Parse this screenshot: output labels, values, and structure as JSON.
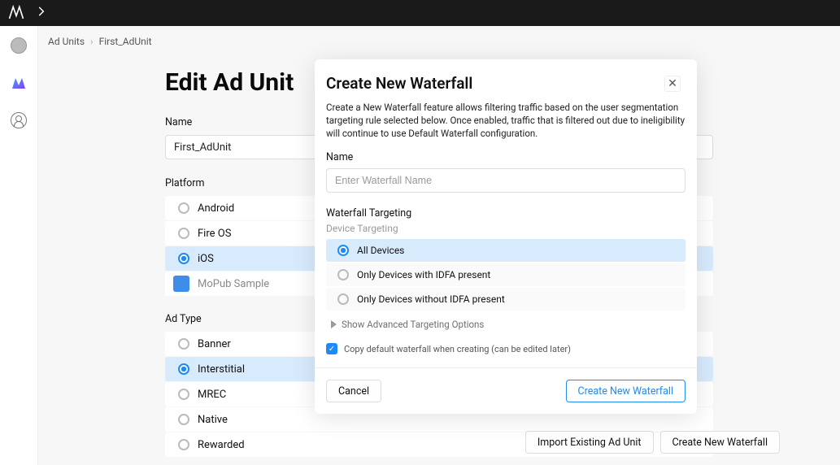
{
  "breadcrumb": {
    "root": "Ad Units",
    "current": "First_AdUnit"
  },
  "page_title": "Edit Ad Unit",
  "name_label": "Name",
  "name_value": "First_AdUnit",
  "platform_label": "Platform",
  "platforms": {
    "android": "Android",
    "fireos": "Fire OS",
    "ios": "iOS",
    "sample": "MoPub Sample"
  },
  "adtype_label": "Ad Type",
  "adtypes": {
    "banner": "Banner",
    "interstitial": "Interstitial",
    "mrec": "MREC",
    "native": "Native",
    "rewarded": "Rewarded"
  },
  "footer": {
    "import": "Import Existing Ad Unit",
    "create": "Create New Waterfall"
  },
  "modal": {
    "title": "Create New Waterfall",
    "desc": "Create a New Waterfall feature allows filtering traffic based on the user segmentation targeting rule selected below. Once enabled, traffic that is filtered out due to ineligibility will continue to use Default Waterfall configuration.",
    "name_label": "Name",
    "name_placeholder": "Enter Waterfall Name",
    "wt_label": "Waterfall Targeting",
    "dt_label": "Device Targeting",
    "devices": {
      "all": "All Devices",
      "idfa": "Only Devices with IDFA present",
      "noidfa": "Only Devices without IDFA present"
    },
    "advanced": "Show Advanced Targeting Options",
    "copy_default": "Copy default waterfall when creating (can be edited later)",
    "cancel": "Cancel",
    "create": "Create New Waterfall"
  }
}
